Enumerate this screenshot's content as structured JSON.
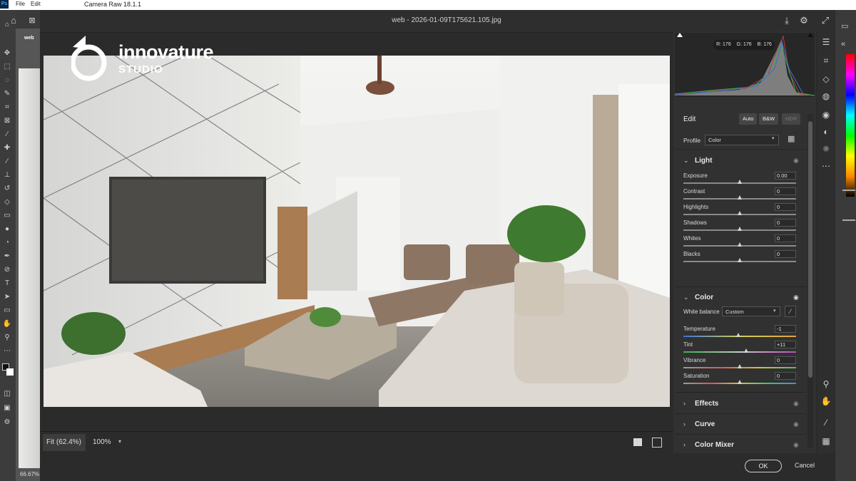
{
  "photoshop": {
    "logo": "Ps",
    "menu": [
      "File",
      "Edit"
    ],
    "zoom_status": "66.67%",
    "doc_tab": "web"
  },
  "dialog": {
    "app_title": "Camera Raw 18.1.1",
    "file_name": "web - 2026-01-09T175621.105.jpg",
    "zoom_fit": "Fit (62.4%)",
    "zoom_100": "100%",
    "ok": "OK",
    "cancel": "Cancel"
  },
  "watermark": {
    "brand": "innovature",
    "sub": "STUDIO"
  },
  "histogram": {
    "r_label": "R: 176",
    "g_label": "G: 176",
    "b_label": "B: 176"
  },
  "edit": {
    "title": "Edit",
    "modes": [
      "Auto",
      "B&W",
      "HDR"
    ],
    "profile_label": "Profile",
    "profile_value": "Color"
  },
  "light": {
    "title": "Light",
    "sliders": [
      {
        "label": "Exposure",
        "value": "0.00",
        "pos": 0.5
      },
      {
        "label": "Contrast",
        "value": "0",
        "pos": 0.5
      },
      {
        "label": "Highlights",
        "value": "0",
        "pos": 0.5
      },
      {
        "label": "Shadows",
        "value": "0",
        "pos": 0.5
      },
      {
        "label": "Whites",
        "value": "0",
        "pos": 0.5
      },
      {
        "label": "Blacks",
        "value": "0",
        "pos": 0.5
      }
    ]
  },
  "color": {
    "title": "Color",
    "wb_label": "White balance",
    "wb_value": "Custom",
    "sliders": [
      {
        "label": "Temperature",
        "value": "-1",
        "pos": 0.49
      },
      {
        "label": "Tint",
        "value": "+11",
        "pos": 0.555
      },
      {
        "label": "Vibrance",
        "value": "0",
        "pos": 0.5
      },
      {
        "label": "Saturation",
        "value": "0",
        "pos": 0.5
      }
    ]
  },
  "sections": [
    "Effects",
    "Curve",
    "Color Mixer"
  ],
  "colors": {
    "accent": "#2d8ceb",
    "panel": "#313131"
  }
}
